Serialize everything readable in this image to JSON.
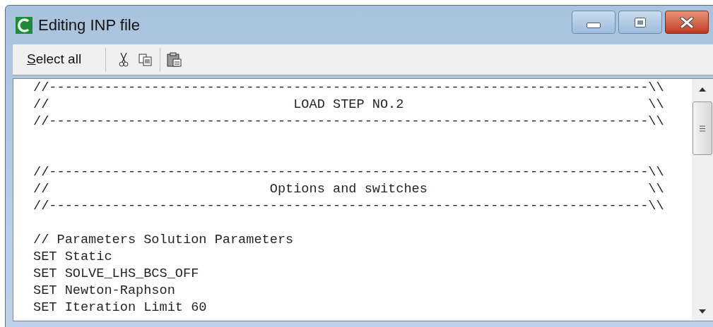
{
  "window": {
    "title": "Editing INP file"
  },
  "toolbar": {
    "select_all": {
      "mnemonic": "S",
      "rest": "elect all"
    }
  },
  "editor": {
    "lines": [
      {
        "kind": "text",
        "text": "//----------------------------------------------------------------------------\\\\"
      },
      {
        "kind": "text",
        "text": "//                               LOAD STEP NO.2                               \\\\"
      },
      {
        "kind": "text",
        "text": "//----------------------------------------------------------------------------\\\\"
      },
      {
        "kind": "blank"
      },
      {
        "kind": "blank"
      },
      {
        "kind": "text",
        "text": "//----------------------------------------------------------------------------\\\\"
      },
      {
        "kind": "text",
        "text": "//                            Options and switches                            \\\\"
      },
      {
        "kind": "text",
        "text": "//----------------------------------------------------------------------------\\\\"
      },
      {
        "kind": "blank"
      },
      {
        "kind": "text",
        "text": "// Parameters Solution Parameters"
      },
      {
        "kind": "text",
        "text": "SET Static"
      },
      {
        "kind": "text",
        "text": "SET SOLVE_LHS_BCS_OFF"
      },
      {
        "kind": "text",
        "text": "SET Newton-Raphson"
      },
      {
        "kind": "text",
        "text": "SET Iteration Limit 60"
      }
    ]
  }
}
